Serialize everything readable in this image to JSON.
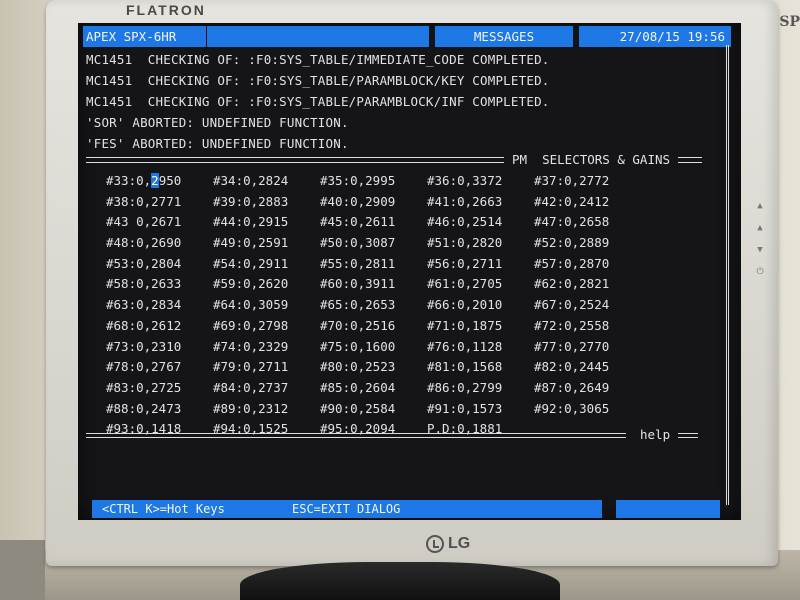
{
  "environment": {
    "monitor_brand": "FLATRON",
    "monitor_logo_text": "LG",
    "side_text": "SP"
  },
  "header": {
    "title": "APEX SPX-6HR",
    "panel_title": "MESSAGES",
    "datetime": "27/08/15 19:56"
  },
  "messages": [
    "MC1451  CHECKING OF: :F0:SYS_TABLE/IMMEDIATE_CODE COMPLETED.",
    "MC1451  CHECKING OF: :F0:SYS_TABLE/PARAMBLOCK/KEY COMPLETED.",
    "MC1451  CHECKING OF: :F0:SYS_TABLE/PARAMBLOCK/INF COMPLETED.",
    "'SOR' ABORTED: UNDEFINED FUNCTION.",
    "'FES' ABORTED: UNDEFINED FUNCTION."
  ],
  "section": {
    "label": "PM  SELECTORS & GAINS"
  },
  "gains": [
    [
      "#33:0,2950",
      "#34:0,2824",
      "#35:0,2995",
      "#36:0,3372",
      "#37:0,2772"
    ],
    [
      "#38:0,2771",
      "#39:0,2883",
      "#40:0,2909",
      "#41:0,2663",
      "#42:0,2412"
    ],
    [
      "#43 0,2671",
      "#44:0,2915",
      "#45:0,2611",
      "#46:0,2514",
      "#47:0,2658"
    ],
    [
      "#48:0,2690",
      "#49:0,2591",
      "#50:0,3087",
      "#51:0,2820",
      "#52:0,2889"
    ],
    [
      "#53:0,2804",
      "#54:0,2911",
      "#55:0,2811",
      "#56:0,2711",
      "#57:0,2870"
    ],
    [
      "#58:0,2633",
      "#59:0,2620",
      "#60:0,3911",
      "#61:0,2705",
      "#62:0,2821"
    ],
    [
      "#63:0,2834",
      "#64:0,3059",
      "#65:0,2653",
      "#66:0,2010",
      "#67:0,2524"
    ],
    [
      "#68:0,2612",
      "#69:0,2798",
      "#70:0,2516",
      "#71:0,1875",
      "#72:0,2558"
    ],
    [
      "#73:0,2310",
      "#74:0,2329",
      "#75:0,1600",
      "#76:0,1128",
      "#77:0,2770"
    ],
    [
      "#78:0,2767",
      "#79:0,2711",
      "#80:0,2523",
      "#81:0,1568",
      "#82:0,2445"
    ],
    [
      "#83:0,2725",
      "#84:0,2737",
      "#85:0,2604",
      "#86:0,2799",
      "#87:0,2649"
    ],
    [
      "#88:0,2473",
      "#89:0,2312",
      "#90:0,2584",
      "#91:0,1573",
      "#92:0,3065"
    ],
    [
      "#93:0,1418",
      "#94:0,1525",
      "#95:0,2094",
      "P.D:0,1881",
      ""
    ]
  ],
  "cursor_cell": {
    "prefix": "#33:0,",
    "highlighted": "2",
    "suffix": "950"
  },
  "help_label": "help",
  "footer": {
    "hotkeys": "<CTRL K>=Hot Keys",
    "esc": "ESC=EXIT DIALOG"
  },
  "colors": {
    "screen_bg": "#151519",
    "accent_blue": "#1d78e6",
    "text": "#e2e2e2"
  }
}
